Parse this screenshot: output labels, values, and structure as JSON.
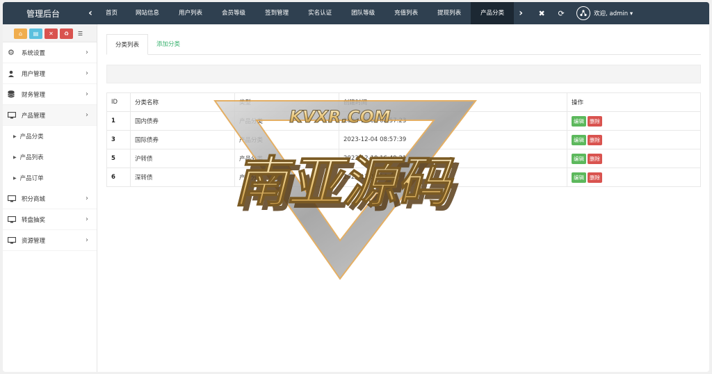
{
  "app": {
    "title": "管理后台"
  },
  "topnav": {
    "tabs": [
      "首页",
      "网站信息",
      "用户列表",
      "会员等级",
      "签到管理",
      "实名认证",
      "团队等级",
      "充值列表",
      "提现列表",
      "产品分类"
    ],
    "active_index": 9,
    "user_label": "欢迎, admin ▾"
  },
  "sidebar": {
    "menu": [
      {
        "label": "系统设置",
        "icon": "cogs-icon"
      },
      {
        "label": "用户管理",
        "icon": "user-icon"
      },
      {
        "label": "财务管理",
        "icon": "database-icon"
      },
      {
        "label": "产品管理",
        "icon": "monitor-icon"
      }
    ],
    "submenu": [
      "产品分类",
      "产品列表",
      "产品订单"
    ],
    "menu_after": [
      {
        "label": "积分商城",
        "icon": "monitor-icon"
      },
      {
        "label": "转盘抽奖",
        "icon": "monitor-icon"
      },
      {
        "label": "资源管理",
        "icon": "monitor-icon"
      }
    ]
  },
  "content": {
    "tabs": [
      "分类列表",
      "添加分类"
    ],
    "table": {
      "headers": [
        "ID",
        "分类名称",
        "类型",
        "创建时间",
        "操作"
      ],
      "rows": [
        {
          "id": "1",
          "name": "国内债券",
          "type": "产品分类",
          "created": "2023-12-04 08:57:23"
        },
        {
          "id": "3",
          "name": "国际债券",
          "type": "产品分类",
          "created": "2023-12-04 08:57:39"
        },
        {
          "id": "5",
          "name": "沪转债",
          "type": "产品分类",
          "created": "2023-12-10 16:49:21"
        },
        {
          "id": "6",
          "name": "深转债",
          "type": "产品分类",
          "created": "2023-12-10 16:49:36"
        }
      ],
      "edit_label": "编辑",
      "delete_label": "删除"
    }
  },
  "watermark": {
    "top": "KVXR.COM",
    "main": "南亚源码"
  },
  "colors": {
    "topbar": "#2f4050",
    "edit": "#5cb85c",
    "delete": "#d9534f",
    "link": "#3cb371"
  }
}
